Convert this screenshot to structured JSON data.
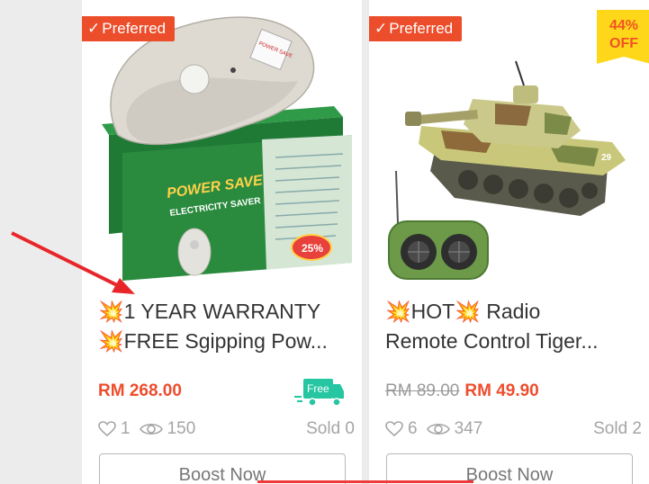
{
  "products": [
    {
      "badge": "Preferred",
      "title_line1": "💥1 YEAR WARRANTY",
      "title_line2": "💥FREE Sgipping Pow...",
      "price": "RM 268.00",
      "free_shipping_label": "Free",
      "likes": "1",
      "views": "150",
      "sold": "Sold 0",
      "button": "Boost Now",
      "image_texts": [
        "POWER SAVE",
        "ELECTRICITY SAVER",
        "25%"
      ]
    },
    {
      "badge": "Preferred",
      "discount_percent": "44%",
      "discount_label": "OFF",
      "title_line1": "💥HOT💥 Radio",
      "title_line2": "Remote Control Tiger...",
      "original_price": "RM 89.00",
      "price": "RM 49.90",
      "likes": "6",
      "views": "347",
      "sold": "Sold 2",
      "button": "Boost Now",
      "image_texts": [
        "29"
      ]
    }
  ],
  "colors": {
    "accent": "#ee4d2d",
    "badge": "#ec4d2b",
    "discount_bg": "#ffd71a",
    "free_ship": "#26c6a2",
    "annotation": "#e8262a"
  },
  "icons": [
    "check-icon",
    "heart-icon",
    "eye-icon",
    "truck-icon"
  ]
}
